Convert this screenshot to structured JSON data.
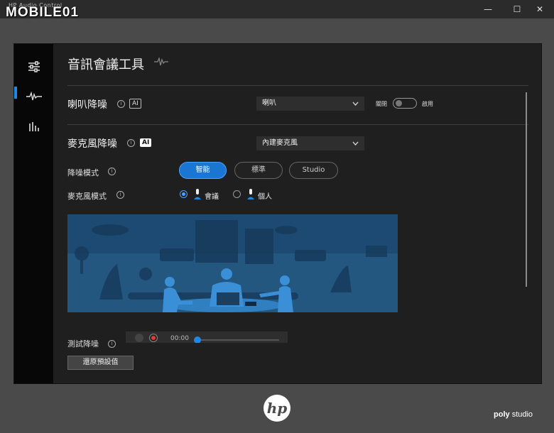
{
  "window": {
    "title": "HP Audio Control",
    "watermark": "MOBILE01",
    "minimize": "—",
    "maximize": "☐",
    "close": "✕"
  },
  "page": {
    "title": "音訊會議工具"
  },
  "speaker_nr": {
    "label": "喇叭降噪",
    "ai": "AI",
    "device": "喇叭",
    "toggle_off": "關閉",
    "toggle_on": "啟用"
  },
  "mic_nr": {
    "label": "麥克風降噪",
    "ai": "AI",
    "device": "內建麥克風",
    "nr_mode_label": "降噪模式",
    "modes": [
      "智能",
      "標準",
      "Studio"
    ],
    "selected_mode": "智能",
    "mic_mode_label": "麥克風模式",
    "mic_modes": [
      "會議",
      "個人"
    ],
    "selected_mic_mode": "會議"
  },
  "test": {
    "label": "測試降噪",
    "time": "00:00"
  },
  "reset_label": "還原預設值",
  "footer": {
    "hp": "hp",
    "poly_a": "poly",
    "poly_b": "studio"
  },
  "icons": [
    "settings-sliders-icon",
    "waveform-icon",
    "equalizer-icon",
    "info-icon",
    "chevron-down-icon",
    "microphone-icon",
    "play-icon",
    "record-icon"
  ],
  "colors": {
    "accent": "#1e88e5",
    "panel": "#1f1f1f",
    "rail": "#070707",
    "illustration": "#1c4a72"
  }
}
